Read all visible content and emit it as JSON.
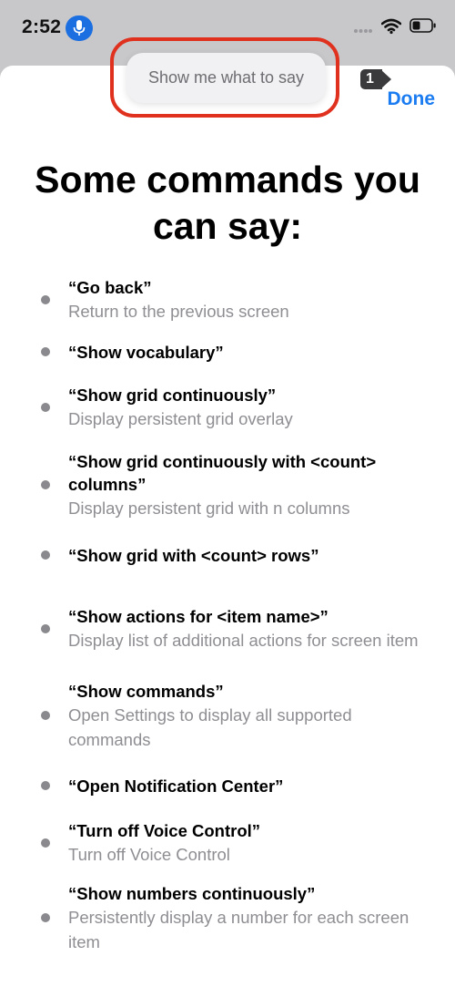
{
  "status_bar": {
    "time": "2:52"
  },
  "header": {
    "hint_label": "Show me what to say",
    "badge_number": "1",
    "done_label": "Done"
  },
  "title": "Some commands you can say:",
  "commands": [
    {
      "phrase": "“Go back”",
      "description": "Return to the previous screen"
    },
    {
      "phrase": "“Show vocabulary”",
      "description": ""
    },
    {
      "phrase": "“Show grid continuously”",
      "description": "Display persistent grid overlay"
    },
    {
      "phrase": "“Show grid continuously with <count> columns”",
      "description": "Display persistent grid with n columns"
    },
    {
      "phrase": "“Show grid with <count> rows”",
      "description": ""
    },
    {
      "phrase": "“Show actions for <item name>”",
      "description": "Display list of additional actions for screen item"
    },
    {
      "phrase": "“Show commands”",
      "description": "Open Settings to display all supported commands"
    },
    {
      "phrase": "“Open Notification Center”",
      "description": ""
    },
    {
      "phrase": "“Turn off Voice Control”",
      "description": "Turn off Voice Control"
    },
    {
      "phrase": "“Show numbers continuously”",
      "description": "Persistently display a number for each screen item"
    }
  ],
  "colors": {
    "accent": "#1a7cf0",
    "highlight": "#e0301e",
    "mic": "#1c6fe0"
  },
  "icons": [
    "microphone-icon",
    "signal-icon",
    "wifi-icon",
    "battery-icon",
    "bullet-icon"
  ]
}
